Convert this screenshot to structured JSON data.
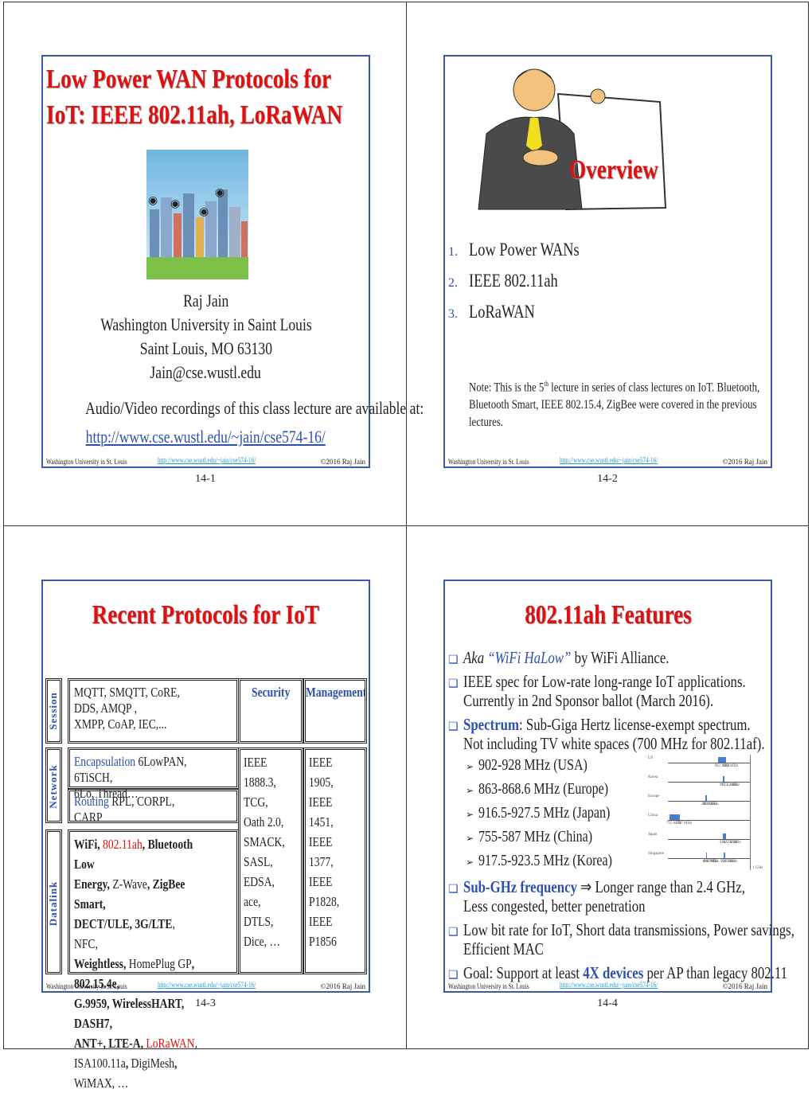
{
  "footer": {
    "left": "Washington University in St. Louis",
    "url": "http://www.cse.wustl.edu/~jain/cse574-16/",
    "right": "©2016 Raj Jain"
  },
  "slide1": {
    "title_line1": "Low Power WAN Protocols for",
    "title_line2": "IoT:  IEEE 802.11ah, LoRaWAN",
    "author": "Raj Jain",
    "affiliation": "Washington University in Saint Louis",
    "city": "Saint Louis, MO 63130",
    "email": "Jain@cse.wustl.edu",
    "recordings": "Audio/Video recordings of this class lecture are available at:",
    "link": "http://www.cse.wustl.edu/~jain/cse574-16/",
    "page": "14-1"
  },
  "slide2": {
    "sign_text": "Overview",
    "items": [
      {
        "num": "1.",
        "text": "Low Power WANs"
      },
      {
        "num": "2.",
        "text": "IEEE 802.11ah"
      },
      {
        "num": "3.",
        "text": "LoRaWAN"
      }
    ],
    "note_a": "Note: This is the 5",
    "note_sup": "th",
    "note_b": " lecture in series of class lectures on IoT. Bluetooth,",
    "note_line2": "Bluetooth Smart, IEEE 802.15.4, ZigBee were covered in the previous",
    "note_line3": "lectures.",
    "page": "14-2"
  },
  "slide3": {
    "title": "Recent Protocols for IoT",
    "layers": [
      "Session",
      "Network",
      "Datalink"
    ],
    "session": {
      "line1": "MQTT, SMQTT, CoRE, DDS, AMQP ,",
      "line2": "XMPP, CoAP, IEC,..."
    },
    "security_header": "Security",
    "management_header": "Management",
    "encapsulation_label": "Encapsulation",
    "encapsulation_text": "6LowPAN, 6TiSCH,",
    "encapsulation_line2": "6Lo, Thread…",
    "routing_label": "Routing",
    "routing_text": "RPL, CORPL, CARP",
    "datalink_lines": [
      [
        {
          "t": "WiFi, ",
          "s": "b"
        },
        {
          "t": "802.11ah",
          "s": "r"
        },
        {
          "t": ", Bluetooth Low",
          "s": "b"
        }
      ],
      [
        {
          "t": "Energy,",
          "s": "b"
        },
        {
          "t": " Z-Wave",
          "s": "n"
        },
        {
          "t": ", ZigBee Smart,",
          "s": "b"
        }
      ],
      [
        {
          "t": "DECT/ULE, 3G/LTE",
          "s": "b"
        },
        {
          "t": ", NFC,",
          "s": "n"
        }
      ],
      [
        {
          "t": "Weightless,",
          "s": "b"
        },
        {
          "t": " HomePlug GP",
          "s": "n"
        },
        {
          "t": ", 802.15.4e,",
          "s": "b"
        }
      ],
      [
        {
          "t": "G.9959, WirelessHART, DASH7,",
          "s": "b"
        }
      ],
      [
        {
          "t": "ANT+, LTE-A, ",
          "s": "b"
        },
        {
          "t": "LoRaWAN",
          "s": "r"
        },
        {
          "t": ",",
          "s": "n"
        }
      ],
      [
        {
          "t": "ISA100.11a",
          "s": "n"
        },
        {
          "t": ",",
          "s": "b"
        },
        {
          "t": " DigiMesh",
          "s": "n"
        },
        {
          "t": ",",
          "s": "b"
        },
        {
          "t": " WiMAX, …",
          "s": "n"
        }
      ]
    ],
    "security_items": [
      "IEEE 1888.3,",
      "TCG,",
      "Oath 2.0,",
      "SMACK,",
      "SASL,",
      "EDSA,",
      "ace,",
      "DTLS,",
      "Dice, …"
    ],
    "management_items": [
      "IEEE 1905,",
      "IEEE 1451,",
      "IEEE 1377,",
      "IEEE P1828,",
      "IEEE P1856"
    ],
    "page": "14-3"
  },
  "slide4": {
    "title": "802.11ah Features",
    "aka_a": "Aka ",
    "aka_b": "“WiFi HaLow”",
    "aka_c": " by WiFi Alliance.",
    "spec_line1": "IEEE spec for Low-rate long-range IoT applications.",
    "spec_line2": "Currently in 2nd Sponsor ballot (March 2016).",
    "spectrum_label": "Spectrum",
    "spectrum_text": ": Sub-Giga Hertz license-exempt spectrum.",
    "spectrum_line2": "Not including TV white spaces (700 MHz for 802.11af).",
    "bands": [
      "902-928 MHz (USA)",
      "863-868.6 MHz (Europe)",
      "916.5-927.5 MHz (Japan)",
      "755-587 MHz (China)",
      "917.5-923.5 MHz (Korea)"
    ],
    "subghz_label": "Sub-GHz frequency",
    "subghz_text": " ⇒ Longer range than 2.4 GHz,",
    "subghz_line2": "Less congested, better penetration",
    "lowbit_line1": "Low bit rate for IoT, Short data transmissions, Power savings,",
    "lowbit_line2": "Efficient MAC",
    "goal_a": "Goal: Support at least ",
    "goal_b": "4X devices",
    "goal_c": " per AP than legacy 802.11",
    "band_chart": {
      "unit": "MHz",
      "end_label": "1 GHz",
      "rows": [
        {
          "country": "US",
          "ranges": [
            [
              902,
              928
            ]
          ]
        },
        {
          "country": "Korea",
          "ranges": [
            [
              917.5,
              923.5
            ]
          ]
        },
        {
          "country": "Europe",
          "ranges": [
            [
              863,
              868
            ]
          ]
        },
        {
          "country": "China",
          "ranges": [
            [
              755,
              787
            ]
          ]
        },
        {
          "country": "Japan",
          "ranges": [
            [
              916.5,
              927.5
            ]
          ]
        },
        {
          "country": "Singapore",
          "ranges": [
            [
              866,
              869
            ],
            [
              920,
              925
            ]
          ]
        }
      ]
    },
    "page": "14-4"
  },
  "colors": {
    "title": "#e01010",
    "accent": "#2d50b0",
    "border": "#3a5ba8",
    "link": "#2a9ad0"
  }
}
